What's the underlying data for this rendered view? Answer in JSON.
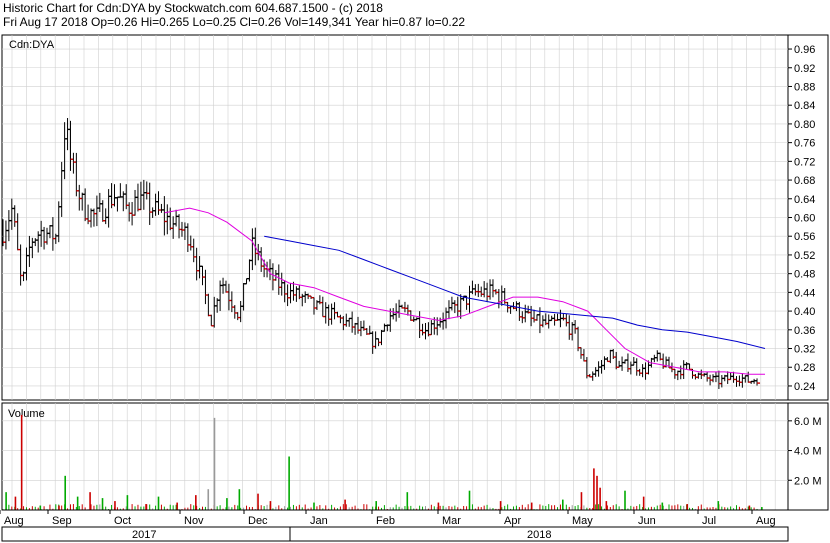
{
  "header": {
    "line1": "Historic Chart for Cdn:DYA by Stockwatch.com 604.687.1500 - (c) 2018",
    "line2": "Fri Aug 17 2018  Op=0.26  Hi=0.265  Lo=0.25  Cl=0.26  Vol=149,341  Year hi=0.87  lo=0.22"
  },
  "colors": {
    "bar_up": "#000000",
    "bar_down": "#cc0000",
    "ma_short": "#e000e0",
    "ma_long": "#0000cc",
    "vol_up": "#00aa00",
    "vol_down": "#cc0000",
    "vol_neutral": "#999999",
    "grid": "#d0d0d0"
  },
  "chart_data": [
    {
      "type": "line",
      "label": "Cdn:DYA",
      "y_ticks": [
        "0.96",
        "0.92",
        "0.88",
        "0.84",
        "0.80",
        "0.76",
        "0.72",
        "0.68",
        "0.64",
        "0.60",
        "0.56",
        "0.52",
        "0.48",
        "0.44",
        "0.40",
        "0.36",
        "0.32",
        "0.28",
        "0.24"
      ],
      "ylim": [
        0.21,
        0.99
      ],
      "x_ticks": [
        "Aug",
        "Sep",
        "Oct",
        "Nov",
        "Dec",
        "Jan",
        "Feb",
        "Mar",
        "Apr",
        "May",
        "Jun",
        "Jul",
        "Aug"
      ],
      "years": [
        "2017",
        "2018"
      ],
      "price_anchors": {
        "x_month_index": [
          0,
          0.15,
          0.3,
          0.45,
          0.6,
          0.85,
          1.0,
          1.1,
          1.2,
          1.3,
          1.5,
          1.8,
          2.0,
          2.2,
          2.5,
          2.8,
          3.0,
          3.2,
          3.35,
          3.5,
          3.6,
          3.8,
          4.0,
          4.2,
          4.4,
          4.6,
          4.8,
          5.0,
          5.3,
          5.6,
          6.0,
          6.2,
          6.5,
          6.8,
          7.0,
          7.3,
          7.6,
          7.9,
          8.1,
          8.3,
          8.5,
          8.8,
          9.0,
          9.2,
          9.4,
          9.6,
          9.75,
          9.9,
          10.1,
          10.3,
          10.5,
          10.8,
          11.0,
          11.2,
          11.5,
          11.8,
          12.0,
          12.2
        ],
        "close": [
          0.57,
          0.62,
          0.45,
          0.55,
          0.57,
          0.56,
          0.8,
          0.71,
          0.66,
          0.62,
          0.6,
          0.65,
          0.62,
          0.64,
          0.61,
          0.58,
          0.56,
          0.46,
          0.38,
          0.47,
          0.44,
          0.39,
          0.54,
          0.49,
          0.46,
          0.44,
          0.43,
          0.41,
          0.39,
          0.37,
          0.33,
          0.39,
          0.4,
          0.36,
          0.38,
          0.41,
          0.44,
          0.44,
          0.42,
          0.4,
          0.38,
          0.37,
          0.38,
          0.35,
          0.26,
          0.28,
          0.31,
          0.28,
          0.29,
          0.27,
          0.3,
          0.27,
          0.28,
          0.26,
          0.25,
          0.26,
          0.25,
          0.26
        ]
      },
      "ma_short": {
        "x_month_index": [
          2.6,
          3.0,
          3.3,
          3.6,
          4.0,
          4.3,
          4.6,
          5.0,
          5.4,
          5.8,
          6.2,
          6.6,
          7.0,
          7.4,
          7.8,
          8.2,
          8.6,
          9.0,
          9.4,
          9.7,
          10.0,
          10.4,
          10.8,
          11.2,
          11.6,
          12.0,
          12.25
        ],
        "values": [
          0.61,
          0.62,
          0.61,
          0.59,
          0.55,
          0.48,
          0.46,
          0.45,
          0.43,
          0.41,
          0.4,
          0.39,
          0.38,
          0.39,
          0.41,
          0.43,
          0.43,
          0.42,
          0.4,
          0.36,
          0.32,
          0.29,
          0.28,
          0.27,
          0.27,
          0.265,
          0.265
        ]
      },
      "ma_long": {
        "x_month_index": [
          4.2,
          4.6,
          5.0,
          5.4,
          5.8,
          6.2,
          6.6,
          7.0,
          7.4,
          7.8,
          8.2,
          8.6,
          9.0,
          9.4,
          9.8,
          10.2,
          10.6,
          11.0,
          11.4,
          11.8,
          12.25
        ],
        "values": [
          0.56,
          0.55,
          0.54,
          0.53,
          0.51,
          0.49,
          0.47,
          0.45,
          0.43,
          0.42,
          0.41,
          0.4,
          0.395,
          0.39,
          0.385,
          0.37,
          0.36,
          0.355,
          0.345,
          0.335,
          0.32
        ]
      }
    },
    {
      "type": "bar",
      "label": "Volume",
      "y_ticks": [
        "6.0 M",
        "4.0 M",
        "2.0 M"
      ],
      "ylim": [
        0,
        7.2
      ],
      "spikes": {
        "x_month_index": [
          0.05,
          0.2,
          0.3,
          0.6,
          0.9,
          1.0,
          1.2,
          1.4,
          1.6,
          1.8,
          2.0,
          2.3,
          2.5,
          2.8,
          3.1,
          3.3,
          3.4,
          3.6,
          3.8,
          4.1,
          4.3,
          4.6,
          5.0,
          5.5,
          6.0,
          6.5,
          7.0,
          7.5,
          8.0,
          8.5,
          9.0,
          9.3,
          9.5,
          9.55,
          9.6,
          9.7,
          10.0,
          10.3,
          10.6,
          11.0,
          11.5,
          12.0,
          12.2
        ],
        "values": [
          1.2,
          0.9,
          6.4,
          0.3,
          0.3,
          2.3,
          0.9,
          1.2,
          0.8,
          0.6,
          1.0,
          0.4,
          0.9,
          0.5,
          1.0,
          1.4,
          6.2,
          0.8,
          1.4,
          1.1,
          0.6,
          3.6,
          0.5,
          0.7,
          0.6,
          1.2,
          0.5,
          1.3,
          0.6,
          0.5,
          0.7,
          1.2,
          2.8,
          2.3,
          1.5,
          0.6,
          1.3,
          0.9,
          0.5,
          0.4,
          0.6,
          0.3,
          0.2
        ],
        "kinds": [
          "up",
          "down",
          "down",
          "up",
          "down",
          "up",
          "up",
          "down",
          "up",
          "down",
          "up",
          "down",
          "up",
          "down",
          "down",
          "neutral",
          "neutral",
          "up",
          "up",
          "down",
          "down",
          "up",
          "up",
          "down",
          "up",
          "up",
          "down",
          "up",
          "down",
          "down",
          "up",
          "down",
          "down",
          "down",
          "down",
          "down",
          "up",
          "down",
          "up",
          "down",
          "up",
          "down",
          "up"
        ]
      }
    }
  ]
}
